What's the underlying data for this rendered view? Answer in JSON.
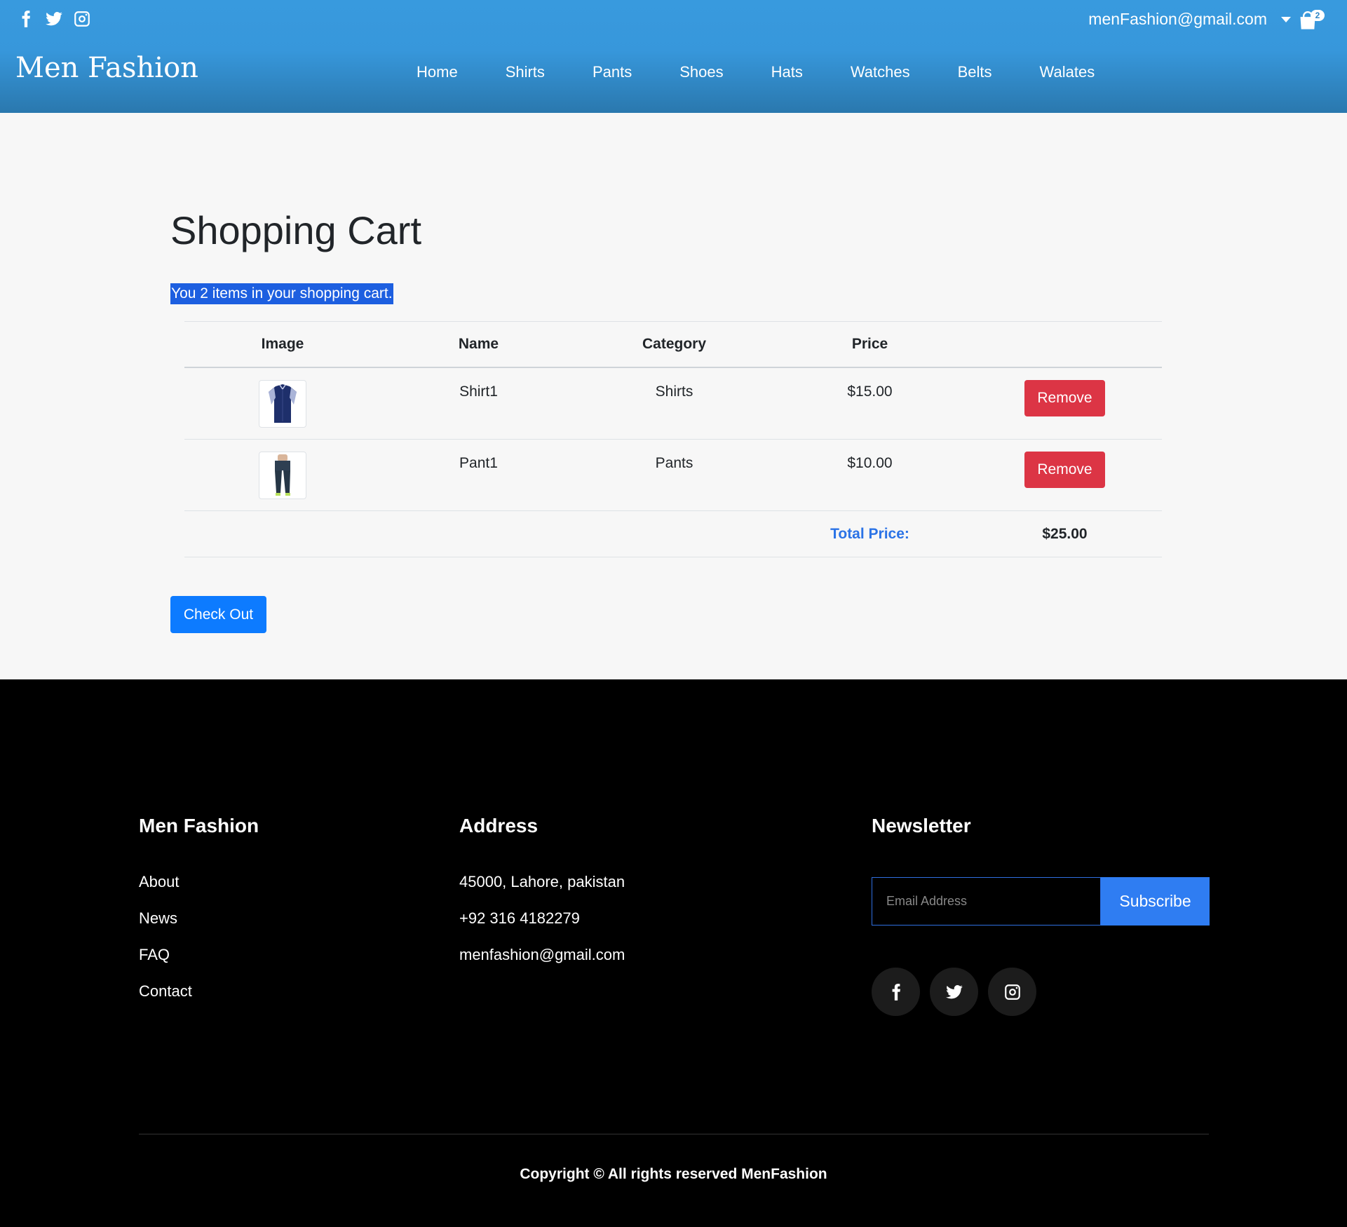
{
  "header": {
    "brand": "Men Fashion",
    "user_email": "menFashion@gmail.com",
    "cart_badge": "2",
    "nav": [
      "Home",
      "Shirts",
      "Pants",
      "Shoes",
      "Hats",
      "Watches",
      "Belts",
      "Walates"
    ]
  },
  "cart": {
    "title": "Shopping Cart",
    "count_text": "You 2 items in your shopping cart.",
    "columns": [
      "Image",
      "Name",
      "Category",
      "Price",
      ""
    ],
    "items": [
      {
        "name": "Shirt1",
        "category": "Shirts",
        "price": "$15.00",
        "action": "Remove",
        "image_icon": "shirt-icon"
      },
      {
        "name": "Pant1",
        "category": "Pants",
        "price": "$10.00",
        "action": "Remove",
        "image_icon": "pants-icon"
      }
    ],
    "total_label": "Total Price:",
    "total_value": "$25.00",
    "checkout_label": "Check Out"
  },
  "footer": {
    "col1": {
      "title": "Men Fashion",
      "links": [
        "About",
        "News",
        "FAQ",
        "Contact"
      ]
    },
    "col2": {
      "title": "Address",
      "lines": [
        "45000, Lahore, pakistan",
        "+92 316 4182279",
        "menfashion@gmail.com"
      ]
    },
    "col3": {
      "title": "Newsletter",
      "email_placeholder": "Email Address",
      "subscribe_label": "Subscribe"
    },
    "copyright": "Copyright © All rights reserved MenFashion"
  },
  "colors": {
    "header_blue": "#389ade",
    "remove_red": "#dc3545",
    "checkout_blue": "#0d7bff",
    "total_label_blue": "#2b73e6",
    "footer_black": "#000000"
  }
}
